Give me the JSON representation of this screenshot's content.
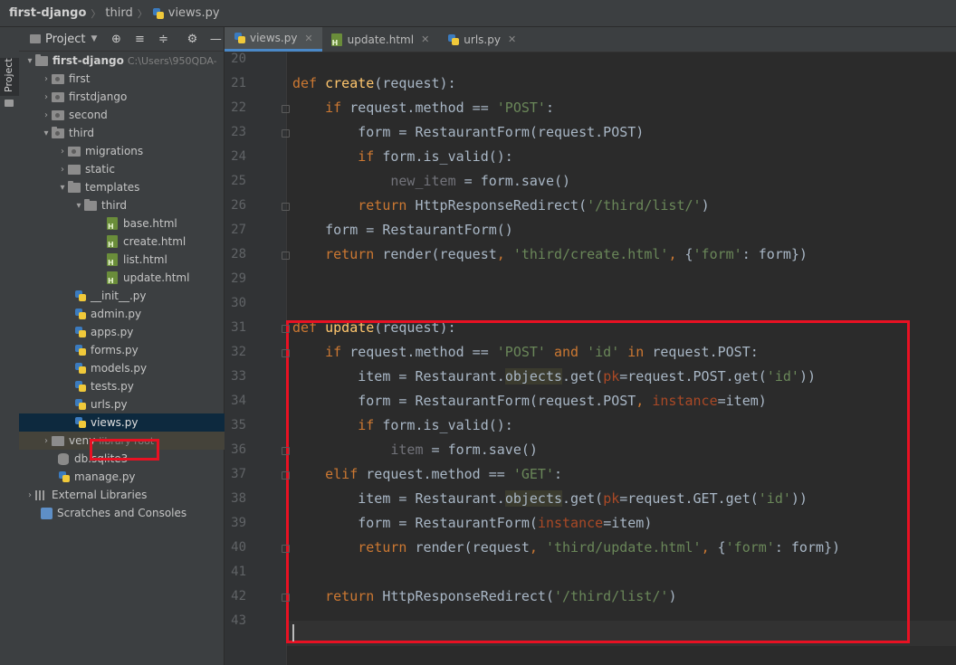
{
  "breadcrumb": [
    "first-django",
    "third",
    "views.py"
  ],
  "toolstrip": {
    "label": "Project"
  },
  "project_panel": {
    "title": "Project"
  },
  "tree": [
    {
      "label": "first-django",
      "hint": "C:\\Users\\950QDA-"
    },
    {
      "label": "first"
    },
    {
      "label": "firstdjango"
    },
    {
      "label": "second"
    },
    {
      "label": "third"
    },
    {
      "label": "migrations"
    },
    {
      "label": "static"
    },
    {
      "label": "templates"
    },
    {
      "label": "third"
    },
    {
      "label": "base.html"
    },
    {
      "label": "create.html"
    },
    {
      "label": "list.html"
    },
    {
      "label": "update.html"
    },
    {
      "label": "__init__.py"
    },
    {
      "label": "admin.py"
    },
    {
      "label": "apps.py"
    },
    {
      "label": "forms.py"
    },
    {
      "label": "models.py"
    },
    {
      "label": "tests.py"
    },
    {
      "label": "urls.py"
    },
    {
      "label": "views.py"
    },
    {
      "label": "venv",
      "hint": "library root"
    },
    {
      "label": "db.sqlite3"
    },
    {
      "label": "manage.py"
    },
    {
      "label": "External Libraries"
    },
    {
      "label": "Scratches and Consoles"
    }
  ],
  "tabs": [
    {
      "label": "views.py",
      "active": true
    },
    {
      "label": "update.html"
    },
    {
      "label": "urls.py"
    }
  ],
  "line_numbers": [
    "20",
    "21",
    "22",
    "23",
    "24",
    "25",
    "26",
    "27",
    "28",
    "29",
    "30",
    "31",
    "32",
    "33",
    "34",
    "35",
    "36",
    "37",
    "38",
    "39",
    "40",
    "41",
    "42",
    "43"
  ],
  "code_lines": [
    "",
    "def create(request):",
    "    if request.method == 'POST':",
    "        form = RestaurantForm(request.POST)",
    "        if form.is_valid():",
    "            new_item = form.save()",
    "        return HttpResponseRedirect('/third/list/')",
    "    form = RestaurantForm()",
    "    return render(request, 'third/create.html', {'form': form})",
    "",
    "",
    "def update(request):",
    "    if request.method == 'POST' and 'id' in request.POST:",
    "        item = Restaurant.objects.get(pk=request.POST.get('id'))",
    "        form = RestaurantForm(request.POST, instance=item)",
    "        if form.is_valid():",
    "            item = form.save()",
    "    elif request.method == 'GET':",
    "        item = Restaurant.objects.get(pk=request.GET.get('id'))",
    "        form = RestaurantForm(instance=item)",
    "        return render(request, 'third/update.html', {'form': form})",
    "",
    "    return HttpResponseRedirect('/third/list/')",
    ""
  ],
  "colors": {
    "keyword": "#cc7832",
    "function": "#ffc66d",
    "string": "#6a8759",
    "param": "#aa4926",
    "highlight_box": "#e81123"
  }
}
